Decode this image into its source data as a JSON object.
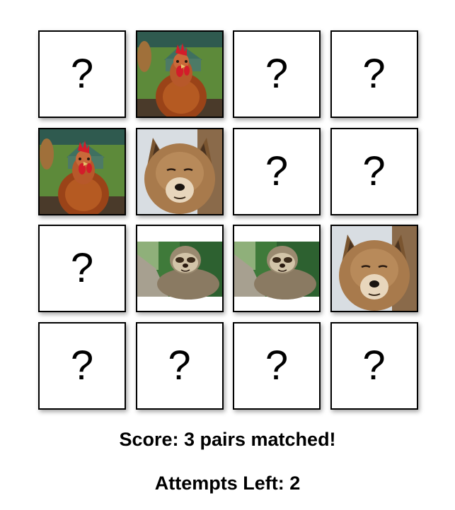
{
  "board": {
    "hidden_symbol": "?",
    "cards": [
      {
        "state": "hidden"
      },
      {
        "state": "revealed",
        "image": "chicken"
      },
      {
        "state": "hidden"
      },
      {
        "state": "hidden"
      },
      {
        "state": "revealed",
        "image": "chicken"
      },
      {
        "state": "revealed",
        "image": "wolf"
      },
      {
        "state": "hidden"
      },
      {
        "state": "hidden"
      },
      {
        "state": "hidden"
      },
      {
        "state": "revealed",
        "image": "sloth"
      },
      {
        "state": "revealed",
        "image": "sloth"
      },
      {
        "state": "revealed",
        "image": "wolf"
      },
      {
        "state": "hidden"
      },
      {
        "state": "hidden"
      },
      {
        "state": "hidden"
      },
      {
        "state": "hidden"
      }
    ]
  },
  "status": {
    "score_text": "Score: 3 pairs matched!",
    "attempts_text": "Attempts Left: 2"
  },
  "colors": {
    "card_border": "#000000",
    "card_bg": "#ffffff",
    "text": "#000000"
  }
}
